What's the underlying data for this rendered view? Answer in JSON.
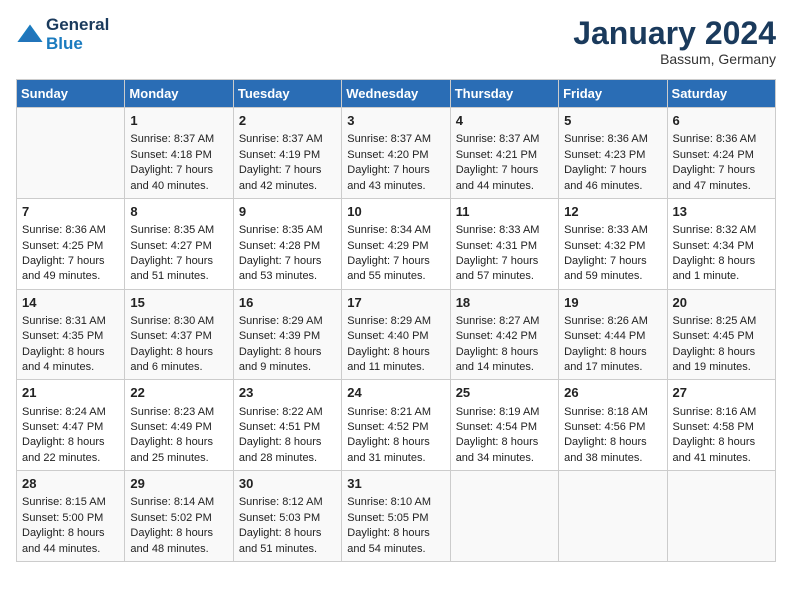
{
  "header": {
    "logo_line1": "General",
    "logo_line2": "Blue",
    "month": "January 2024",
    "location": "Bassum, Germany"
  },
  "weekdays": [
    "Sunday",
    "Monday",
    "Tuesday",
    "Wednesday",
    "Thursday",
    "Friday",
    "Saturday"
  ],
  "weeks": [
    [
      {
        "day": "",
        "sunrise": "",
        "sunset": "",
        "daylight": ""
      },
      {
        "day": "1",
        "sunrise": "Sunrise: 8:37 AM",
        "sunset": "Sunset: 4:18 PM",
        "daylight": "Daylight: 7 hours and 40 minutes."
      },
      {
        "day": "2",
        "sunrise": "Sunrise: 8:37 AM",
        "sunset": "Sunset: 4:19 PM",
        "daylight": "Daylight: 7 hours and 42 minutes."
      },
      {
        "day": "3",
        "sunrise": "Sunrise: 8:37 AM",
        "sunset": "Sunset: 4:20 PM",
        "daylight": "Daylight: 7 hours and 43 minutes."
      },
      {
        "day": "4",
        "sunrise": "Sunrise: 8:37 AM",
        "sunset": "Sunset: 4:21 PM",
        "daylight": "Daylight: 7 hours and 44 minutes."
      },
      {
        "day": "5",
        "sunrise": "Sunrise: 8:36 AM",
        "sunset": "Sunset: 4:23 PM",
        "daylight": "Daylight: 7 hours and 46 minutes."
      },
      {
        "day": "6",
        "sunrise": "Sunrise: 8:36 AM",
        "sunset": "Sunset: 4:24 PM",
        "daylight": "Daylight: 7 hours and 47 minutes."
      }
    ],
    [
      {
        "day": "7",
        "sunrise": "Sunrise: 8:36 AM",
        "sunset": "Sunset: 4:25 PM",
        "daylight": "Daylight: 7 hours and 49 minutes."
      },
      {
        "day": "8",
        "sunrise": "Sunrise: 8:35 AM",
        "sunset": "Sunset: 4:27 PM",
        "daylight": "Daylight: 7 hours and 51 minutes."
      },
      {
        "day": "9",
        "sunrise": "Sunrise: 8:35 AM",
        "sunset": "Sunset: 4:28 PM",
        "daylight": "Daylight: 7 hours and 53 minutes."
      },
      {
        "day": "10",
        "sunrise": "Sunrise: 8:34 AM",
        "sunset": "Sunset: 4:29 PM",
        "daylight": "Daylight: 7 hours and 55 minutes."
      },
      {
        "day": "11",
        "sunrise": "Sunrise: 8:33 AM",
        "sunset": "Sunset: 4:31 PM",
        "daylight": "Daylight: 7 hours and 57 minutes."
      },
      {
        "day": "12",
        "sunrise": "Sunrise: 8:33 AM",
        "sunset": "Sunset: 4:32 PM",
        "daylight": "Daylight: 7 hours and 59 minutes."
      },
      {
        "day": "13",
        "sunrise": "Sunrise: 8:32 AM",
        "sunset": "Sunset: 4:34 PM",
        "daylight": "Daylight: 8 hours and 1 minute."
      }
    ],
    [
      {
        "day": "14",
        "sunrise": "Sunrise: 8:31 AM",
        "sunset": "Sunset: 4:35 PM",
        "daylight": "Daylight: 8 hours and 4 minutes."
      },
      {
        "day": "15",
        "sunrise": "Sunrise: 8:30 AM",
        "sunset": "Sunset: 4:37 PM",
        "daylight": "Daylight: 8 hours and 6 minutes."
      },
      {
        "day": "16",
        "sunrise": "Sunrise: 8:29 AM",
        "sunset": "Sunset: 4:39 PM",
        "daylight": "Daylight: 8 hours and 9 minutes."
      },
      {
        "day": "17",
        "sunrise": "Sunrise: 8:29 AM",
        "sunset": "Sunset: 4:40 PM",
        "daylight": "Daylight: 8 hours and 11 minutes."
      },
      {
        "day": "18",
        "sunrise": "Sunrise: 8:27 AM",
        "sunset": "Sunset: 4:42 PM",
        "daylight": "Daylight: 8 hours and 14 minutes."
      },
      {
        "day": "19",
        "sunrise": "Sunrise: 8:26 AM",
        "sunset": "Sunset: 4:44 PM",
        "daylight": "Daylight: 8 hours and 17 minutes."
      },
      {
        "day": "20",
        "sunrise": "Sunrise: 8:25 AM",
        "sunset": "Sunset: 4:45 PM",
        "daylight": "Daylight: 8 hours and 19 minutes."
      }
    ],
    [
      {
        "day": "21",
        "sunrise": "Sunrise: 8:24 AM",
        "sunset": "Sunset: 4:47 PM",
        "daylight": "Daylight: 8 hours and 22 minutes."
      },
      {
        "day": "22",
        "sunrise": "Sunrise: 8:23 AM",
        "sunset": "Sunset: 4:49 PM",
        "daylight": "Daylight: 8 hours and 25 minutes."
      },
      {
        "day": "23",
        "sunrise": "Sunrise: 8:22 AM",
        "sunset": "Sunset: 4:51 PM",
        "daylight": "Daylight: 8 hours and 28 minutes."
      },
      {
        "day": "24",
        "sunrise": "Sunrise: 8:21 AM",
        "sunset": "Sunset: 4:52 PM",
        "daylight": "Daylight: 8 hours and 31 minutes."
      },
      {
        "day": "25",
        "sunrise": "Sunrise: 8:19 AM",
        "sunset": "Sunset: 4:54 PM",
        "daylight": "Daylight: 8 hours and 34 minutes."
      },
      {
        "day": "26",
        "sunrise": "Sunrise: 8:18 AM",
        "sunset": "Sunset: 4:56 PM",
        "daylight": "Daylight: 8 hours and 38 minutes."
      },
      {
        "day": "27",
        "sunrise": "Sunrise: 8:16 AM",
        "sunset": "Sunset: 4:58 PM",
        "daylight": "Daylight: 8 hours and 41 minutes."
      }
    ],
    [
      {
        "day": "28",
        "sunrise": "Sunrise: 8:15 AM",
        "sunset": "Sunset: 5:00 PM",
        "daylight": "Daylight: 8 hours and 44 minutes."
      },
      {
        "day": "29",
        "sunrise": "Sunrise: 8:14 AM",
        "sunset": "Sunset: 5:02 PM",
        "daylight": "Daylight: 8 hours and 48 minutes."
      },
      {
        "day": "30",
        "sunrise": "Sunrise: 8:12 AM",
        "sunset": "Sunset: 5:03 PM",
        "daylight": "Daylight: 8 hours and 51 minutes."
      },
      {
        "day": "31",
        "sunrise": "Sunrise: 8:10 AM",
        "sunset": "Sunset: 5:05 PM",
        "daylight": "Daylight: 8 hours and 54 minutes."
      },
      {
        "day": "",
        "sunrise": "",
        "sunset": "",
        "daylight": ""
      },
      {
        "day": "",
        "sunrise": "",
        "sunset": "",
        "daylight": ""
      },
      {
        "day": "",
        "sunrise": "",
        "sunset": "",
        "daylight": ""
      }
    ]
  ]
}
